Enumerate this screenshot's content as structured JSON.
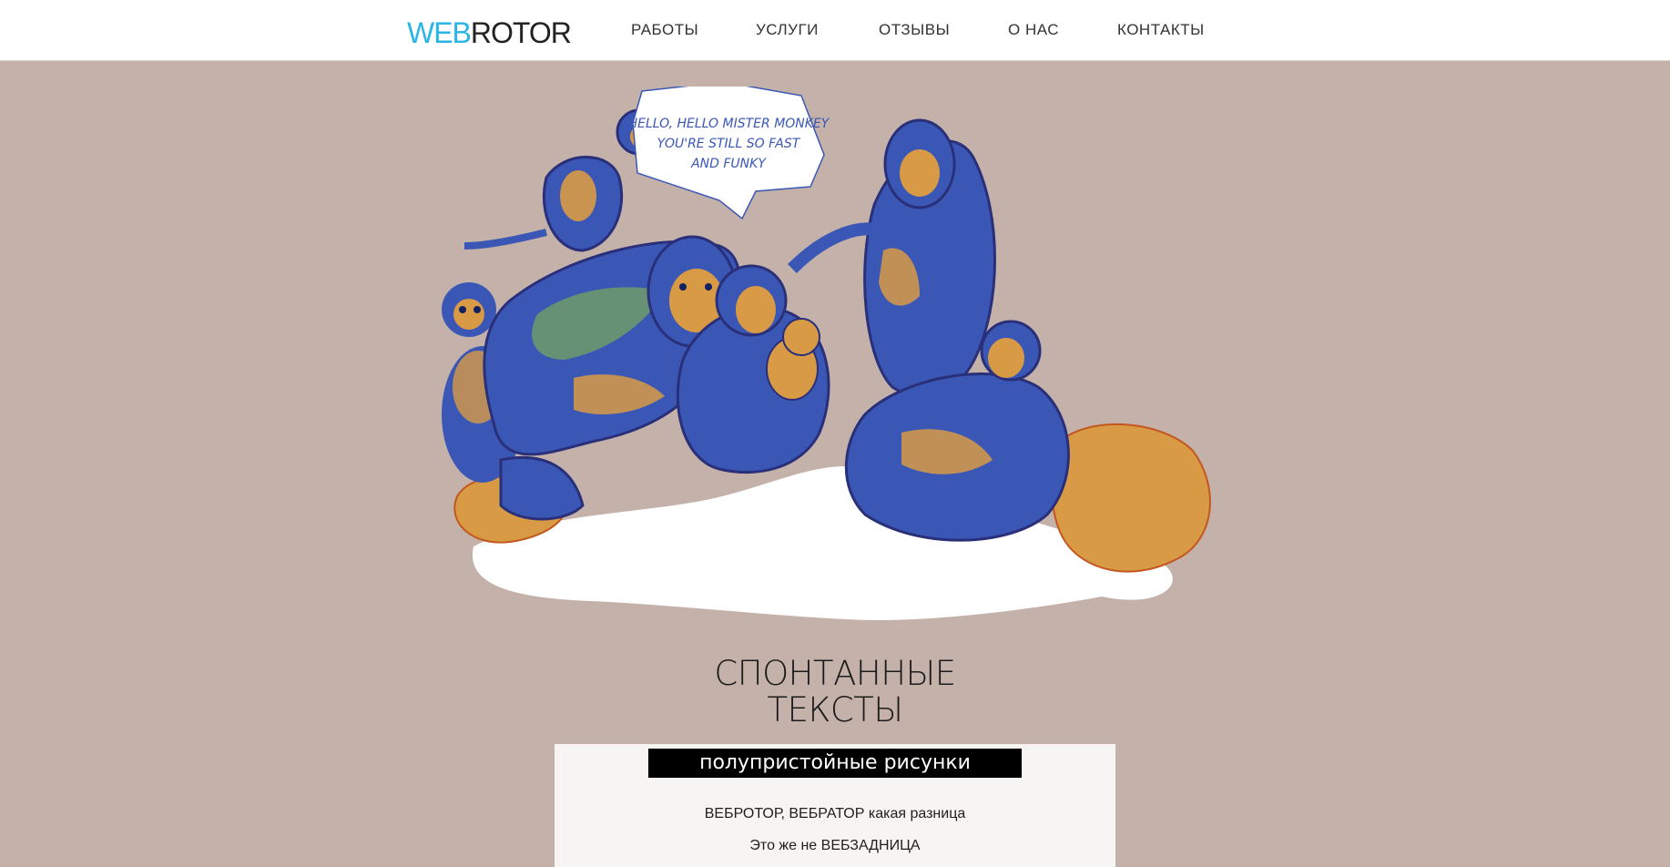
{
  "header": {
    "logo_part1": "WEB",
    "logo_part2": "ROTOR",
    "nav": [
      {
        "label": "РАБОТЫ"
      },
      {
        "label": "УСЛУГИ"
      },
      {
        "label": "ОТЗЫВЫ"
      },
      {
        "label": "О НАС"
      },
      {
        "label": "КОНТАКТЫ"
      }
    ]
  },
  "hero": {
    "speech_line1": "HELLO, HELLO MISTER MONKEY",
    "speech_line2": "YOU'RE STILL SO FAST",
    "speech_line3": "AND FUNKY"
  },
  "section": {
    "title_line1": "СПОНТАННЫЕ",
    "title_line2": "ТЕКСТЫ",
    "tag": "полупристойные рисунки",
    "text_line1": "ВЕБРОТОР, ВЕБРАТОР какая разница",
    "text_line2": "Это же не ВЕБЗАДНИЦА"
  },
  "colors": {
    "background": "#c4b1a9",
    "header_bg": "#ffffff",
    "logo_accent": "#29b6e6",
    "monkey_blue": "#3a57b5",
    "monkey_orange": "#d99a45",
    "monkey_green": "#6f9b6a",
    "card_bg": "#f7f5f3",
    "tag_bg": "#000000"
  }
}
